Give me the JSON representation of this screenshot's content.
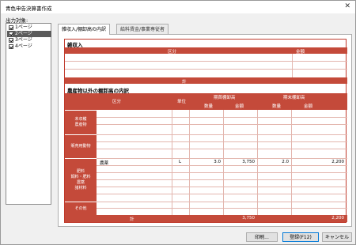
{
  "window": {
    "title": "青色申告決算書作成",
    "close_glyph": "✕"
  },
  "output_target": {
    "label": "出力対象:",
    "pages": [
      {
        "label": "1ページ",
        "checked": true,
        "selected": false
      },
      {
        "label": "2ページ",
        "checked": true,
        "selected": true
      },
      {
        "label": "3ページ",
        "checked": true,
        "selected": false
      },
      {
        "label": "4ページ",
        "checked": true,
        "selected": false
      }
    ]
  },
  "tabs": [
    {
      "label": "雑収入/棚卸高の内訳",
      "active": true
    },
    {
      "label": "給料賃金/事業専従者",
      "active": false
    }
  ],
  "misc_income": {
    "title": "雑収入",
    "headers": {
      "category": "区分",
      "amount": "金額"
    },
    "total_label": "計"
  },
  "inventory": {
    "title": "農産物以外の棚卸高の内訳",
    "headers": {
      "category": "区分",
      "unit": "単位",
      "opening": "期首棚卸高",
      "closing": "期末棚卸高",
      "qty": "数量",
      "amount": "金額"
    },
    "categories": [
      "未収穫\n農産物",
      "販売用動物",
      "肥料\n飼料・肥料\n農薬\n諸材料",
      "その他"
    ],
    "row": {
      "item": "農薬",
      "unit": "L",
      "open_qty": "3.0",
      "open_amount": "3,750",
      "close_qty": "2.0",
      "close_amount": "2,200"
    },
    "total_label": "計",
    "total_open_amount": "3,750",
    "total_close_amount": "2,200"
  },
  "buttons": {
    "print": "印刷...",
    "register": "登録(F12)",
    "cancel": "キャンセル"
  },
  "colors": {
    "accent": "#c44a3a",
    "border": "#c0392b"
  }
}
